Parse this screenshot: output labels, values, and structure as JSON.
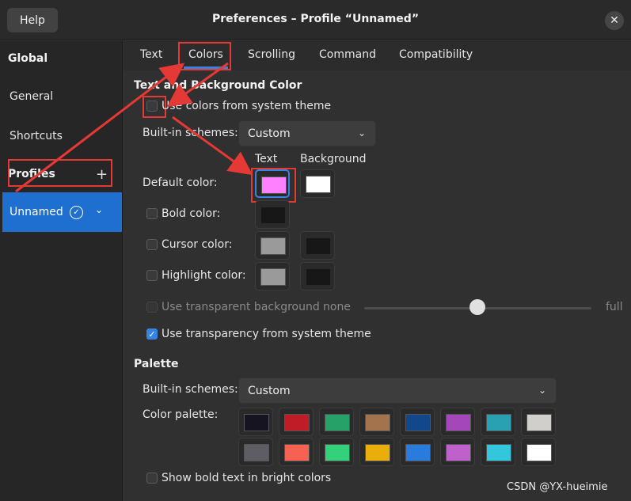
{
  "titlebar": {
    "help_label": "Help",
    "title": "Preferences – Profile “Unnamed”",
    "close_glyph": "✕"
  },
  "sidebar": {
    "global_heading": "Global",
    "items": [
      "General",
      "Shortcuts"
    ],
    "profiles_heading": "Profiles",
    "add_glyph": "+",
    "profile": {
      "label": "Unnamed",
      "check_glyph": "✓",
      "chevron_glyph": "⌄"
    }
  },
  "tabs": [
    "Text",
    "Colors",
    "Scrolling",
    "Command",
    "Compatibility"
  ],
  "text_bg": {
    "heading": "Text and Background Color",
    "use_system_theme": "Use colors from system theme",
    "builtin_label": "Built-in schemes:",
    "builtin_value": "Custom",
    "col_text": "Text",
    "col_background": "Background",
    "default_color": "Default color:",
    "bold_color": "Bold color:",
    "cursor_color": "Cursor color:",
    "highlight_color": "Highlight color:",
    "transparent_bg": "Use transparent background",
    "none": "none",
    "full": "full",
    "transparency_system": "Use transparency from system theme",
    "transparency_level": 0.5
  },
  "palette": {
    "heading": "Palette",
    "builtin_label": "Built-in schemes:",
    "builtin_value": "Custom",
    "color_palette_label": "Color palette:",
    "row1": [
      "#171421",
      "#c01c28",
      "#26a269",
      "#a2734c",
      "#12488b",
      "#a347ba",
      "#2aa1b3",
      "#d0cfcc"
    ],
    "row2": [
      "#5e5c64",
      "#f66151",
      "#33d17a",
      "#e9ad0c",
      "#2a7bde",
      "#c061cb",
      "#33c7de",
      "#ffffff"
    ],
    "bold_bright": "Show bold text in bright colors"
  },
  "colors": {
    "text_default": "#ff80ff",
    "bg_default": "#ffffff",
    "accent": "#3584e4",
    "annotation": "#e53935"
  },
  "watermark": "CSDN @YX-hueimie"
}
